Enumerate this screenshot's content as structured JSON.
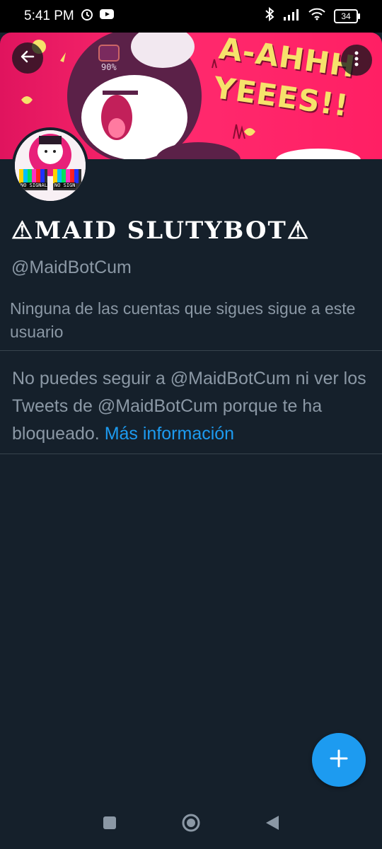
{
  "status_bar": {
    "time": "5:41 PM",
    "battery": "34",
    "icons": [
      "alarm-icon",
      "youtube-icon",
      "bluetooth-icon",
      "signal-icon",
      "wifi-icon",
      "battery-icon"
    ]
  },
  "banner": {
    "line1": "A-AHHH",
    "line2": "YEEES!!",
    "label": "90%"
  },
  "avatar": {
    "label1": "NO SIGNAL",
    "label2": "NO SIGN"
  },
  "profile": {
    "display_name": "⚠MAID SLUTYBOT⚠",
    "handle": "@MaidBotCum",
    "follow_note": "Ninguna de las cuentas que sigues sigue a este usuario"
  },
  "blocked": {
    "message": "No puedes seguir a @MaidBotCum ni ver los Tweets de @MaidBotCum porque te ha bloqueado. ",
    "link": "Más información"
  },
  "colors": {
    "background": "#15202b",
    "accent": "#1d9bf0",
    "secondary_text": "#8b98a5",
    "banner": "#ff2a6e"
  }
}
